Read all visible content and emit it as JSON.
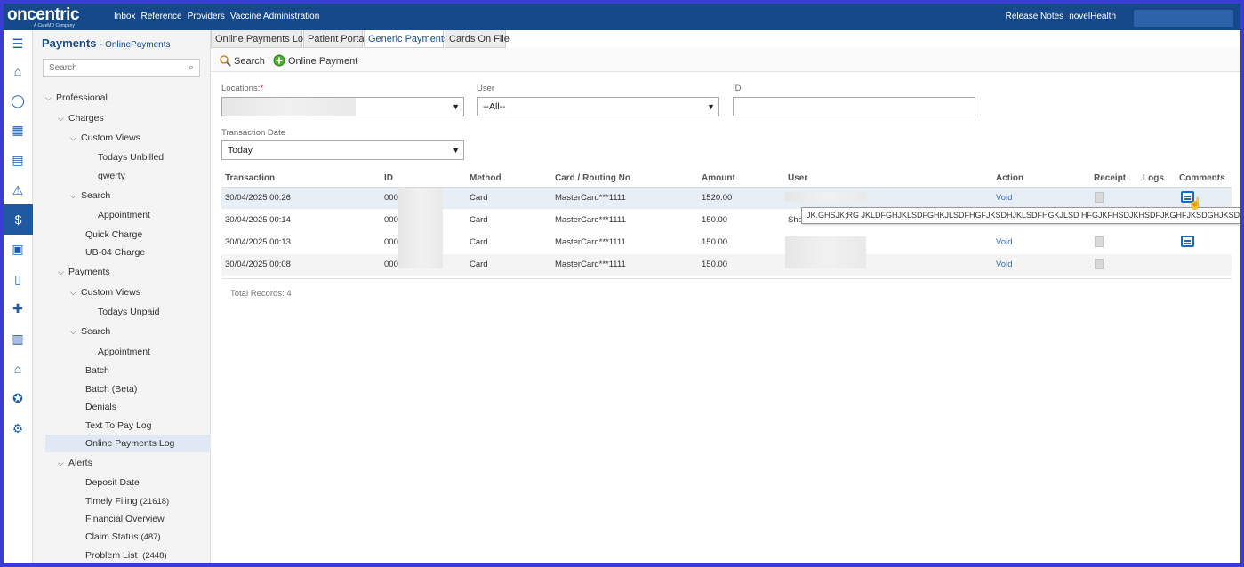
{
  "topbar": {
    "logo_text": "oncentric",
    "logo_sub": "A CareMD Company",
    "nav": [
      "Inbox",
      "Reference",
      "Providers",
      "Vaccine Administration"
    ],
    "right": [
      "Release Notes",
      "novelHealth"
    ]
  },
  "rail": {
    "icons": [
      "menu-icon",
      "home-icon",
      "person-icon",
      "calendar-icon",
      "ledger-icon",
      "alert-icon",
      "payments-icon",
      "billing-icon",
      "document-icon",
      "hospital-icon",
      "film-icon",
      "house-icon",
      "badge-icon",
      "gear-icon"
    ],
    "active": "payments-icon"
  },
  "side": {
    "title": "Payments",
    "subtitle": "- OnlinePayments",
    "search_placeholder": "Search",
    "tree": [
      {
        "label": "Professional",
        "chevron": true
      },
      {
        "label": "Charges",
        "chevron": true
      },
      {
        "label": "Custom Views",
        "chevron": true
      },
      {
        "label": "Todays Unbilled"
      },
      {
        "label": "qwerty"
      },
      {
        "label": "Search",
        "chevron": true
      },
      {
        "label": "Appointment"
      },
      {
        "label": "Quick Charge"
      },
      {
        "label": "UB-04 Charge"
      },
      {
        "label": "Payments",
        "chevron": true
      },
      {
        "label": "Custom Views",
        "chevron": true
      },
      {
        "label": "Todays Unpaid"
      },
      {
        "label": "Search",
        "chevron": true
      },
      {
        "label": "Appointment"
      },
      {
        "label": "Batch"
      },
      {
        "label": "Batch (Beta)"
      },
      {
        "label": "Denials"
      },
      {
        "label": "Text To Pay Log"
      },
      {
        "label": "Online Payments Log",
        "selected": true
      },
      {
        "label": "Alerts",
        "chevron": true
      },
      {
        "label": "Deposit Date"
      },
      {
        "label": "Timely Filing",
        "count": "(21618)"
      },
      {
        "label": "Financial Overview"
      },
      {
        "label": "Claim Status",
        "count": "(487)"
      },
      {
        "label": "Problem List",
        "count": "(2448)"
      }
    ]
  },
  "tabs": [
    "Online Payments Log",
    "Patient Portal",
    "Generic Payments",
    "Cards On File"
  ],
  "active_tab": "Generic Payments",
  "toolbar": {
    "search_label": "Search",
    "online_payment_label": "Online Payment"
  },
  "filters": {
    "locations_label": "Locations:",
    "locations_required": "*",
    "user_label": "User",
    "user_value": "--All--",
    "id_label": "ID",
    "id_value": "",
    "date_label": "Transaction Date",
    "date_value": "Today"
  },
  "table": {
    "headers": [
      "Transaction",
      "ID",
      "Method",
      "Card / Routing No",
      "Amount",
      "User",
      "Action",
      "Receipt",
      "Logs",
      "Comments"
    ],
    "rows": [
      {
        "transaction": "30/04/2025 00:26",
        "id": "000",
        "method": "Card",
        "card": "MasterCard***1111",
        "amount": "1520.00",
        "user": "",
        "action": "Void"
      },
      {
        "transaction": "30/04/2025 00:14",
        "id": "000",
        "method": "Card",
        "card": "MasterCard***1111",
        "amount": "150.00",
        "user": "Sha",
        "action": ""
      },
      {
        "transaction": "30/04/2025 00:13",
        "id": "000",
        "method": "Card",
        "card": "MasterCard***1111",
        "amount": "150.00",
        "user": "",
        "action": "Void"
      },
      {
        "transaction": "30/04/2025 00:08",
        "id": "000",
        "method": "Card",
        "card": "MasterCard***1111",
        "amount": "150.00",
        "user": "",
        "action": "Void"
      }
    ],
    "total_label": "Total Records:",
    "total_value": "4",
    "tooltip": "JK.GHSJK;RG JKLDFGHJKLSDFGHKJLSDFHGFJKSDHJKLSDFHGKJLSD HFGJKFHSDJKHSDFJKGHFJKSDGHJKSDFHGJKLSDFHGKDSF"
  },
  "colors": {
    "topbar": "#15498a",
    "accent": "#1f5aa0",
    "link": "#3b6fb6"
  }
}
